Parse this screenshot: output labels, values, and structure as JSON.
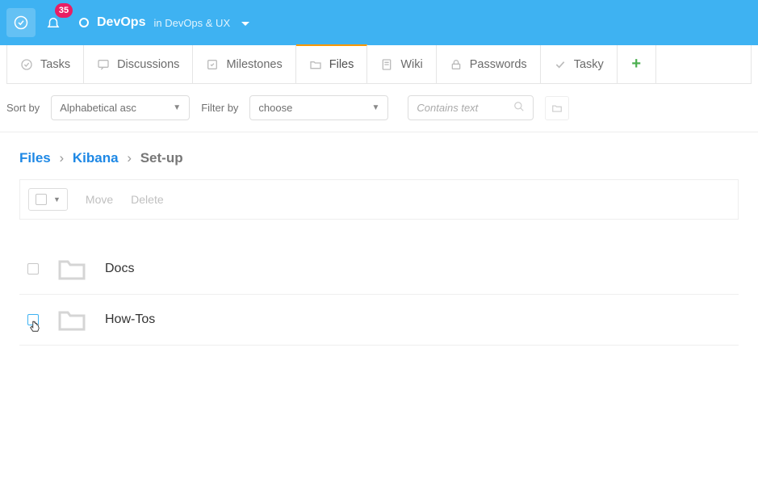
{
  "header": {
    "badge_count": "35",
    "project_name": "DevOps",
    "project_context": "in DevOps & UX"
  },
  "tabs": {
    "tasks": "Tasks",
    "discussions": "Discussions",
    "milestones": "Milestones",
    "files": "Files",
    "wiki": "Wiki",
    "passwords": "Passwords",
    "tasky": "Tasky"
  },
  "filter_bar": {
    "sort_label": "Sort by",
    "sort_value": "Alphabetical asc",
    "filter_label": "Filter by",
    "filter_value": "choose",
    "search_placeholder": "Contains text"
  },
  "breadcrumb": {
    "root": "Files",
    "folder": "Kibana",
    "current": "Set-up"
  },
  "toolbar": {
    "move_label": "Move",
    "delete_label": "Delete"
  },
  "files": [
    {
      "name": "Docs"
    },
    {
      "name": "How-Tos"
    }
  ]
}
